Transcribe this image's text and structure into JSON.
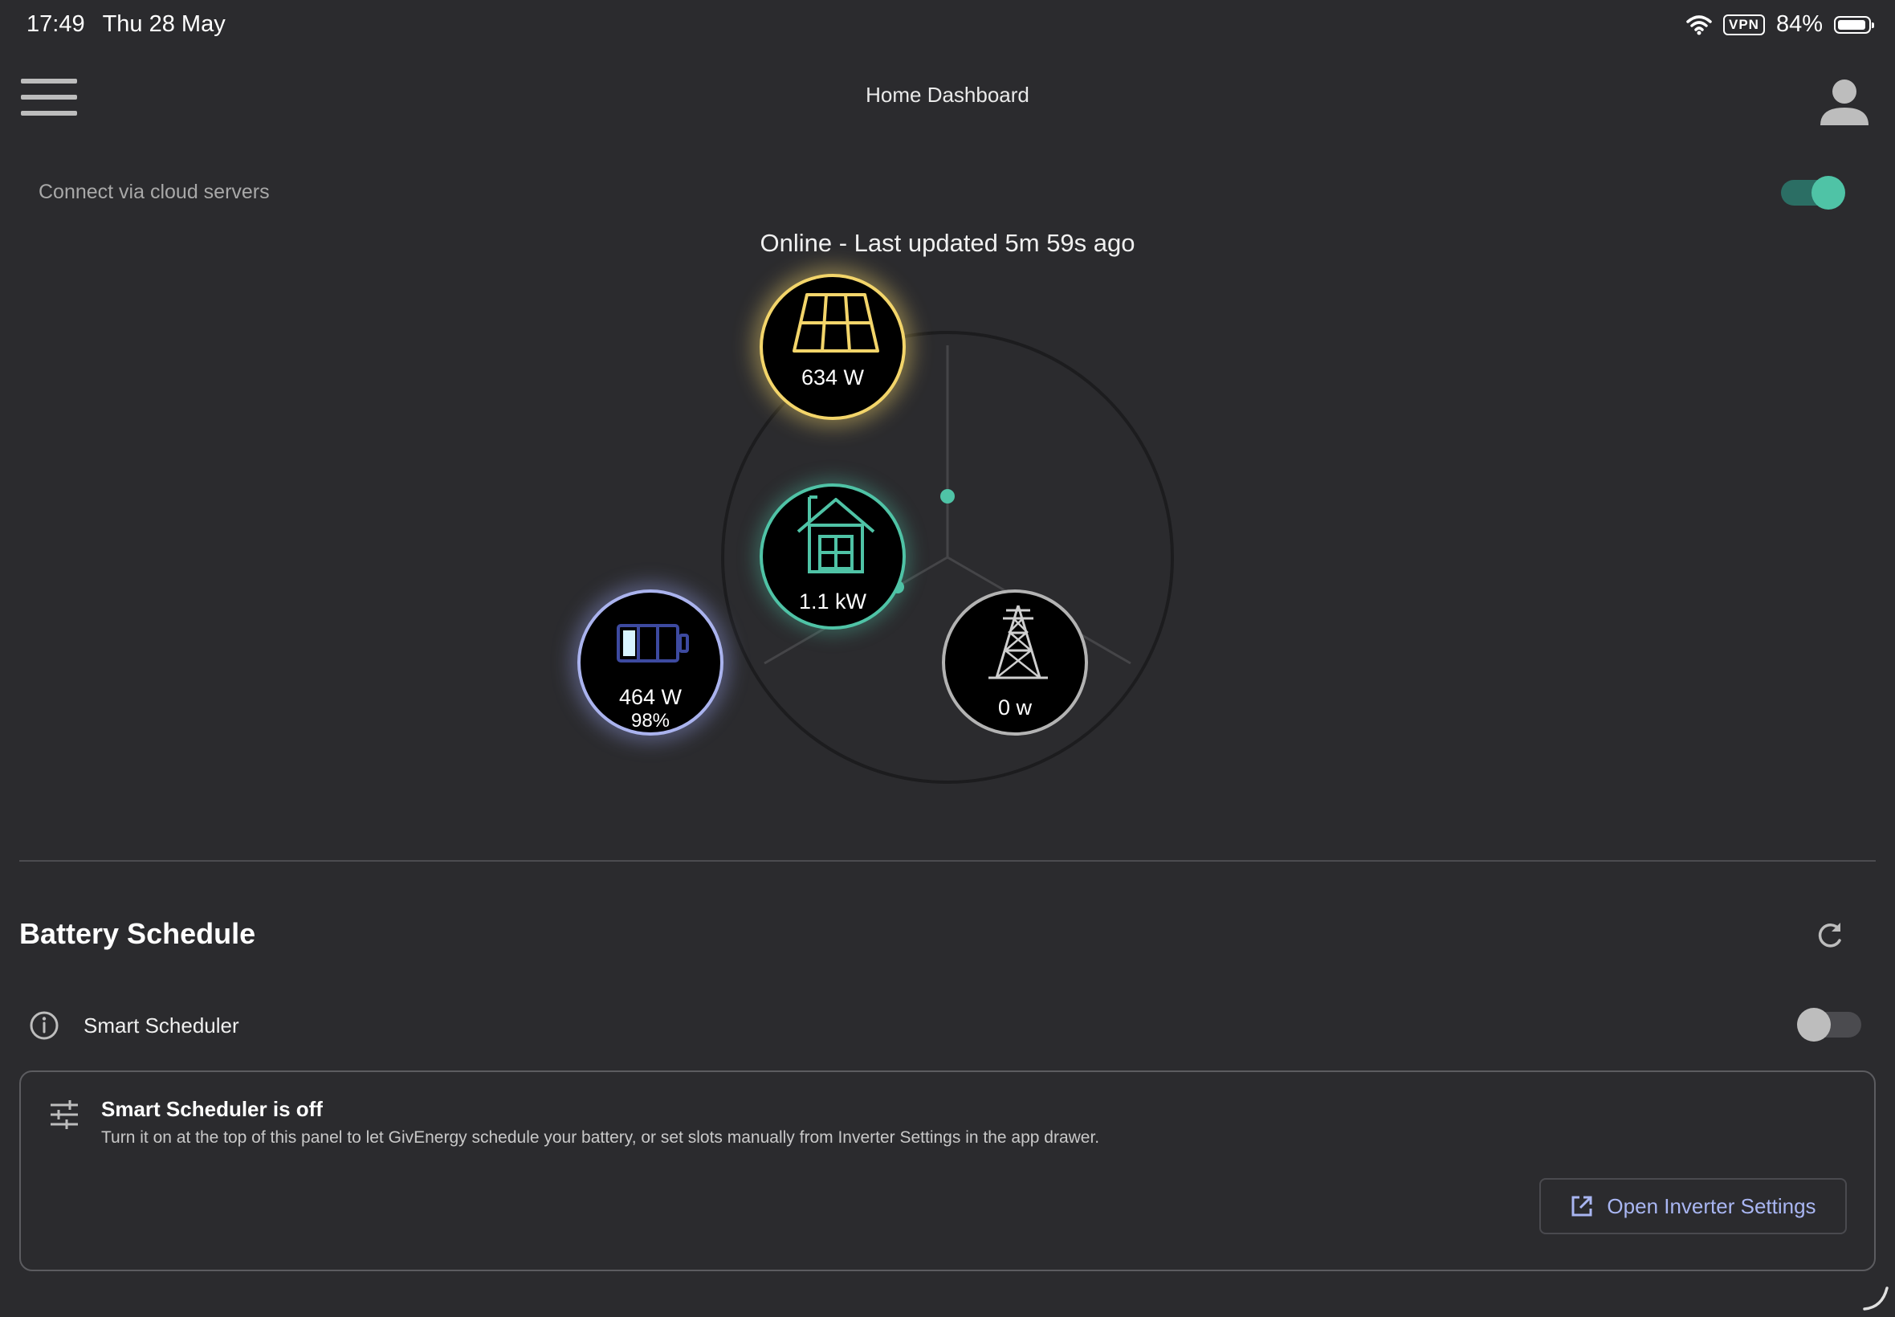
{
  "status_bar": {
    "time": "17:49",
    "date": "Thu 28 May",
    "vpn": "VPN",
    "battery_percent": "84%"
  },
  "header": {
    "title": "Home Dashboard"
  },
  "cloud": {
    "label": "Connect via cloud servers",
    "enabled": true
  },
  "status": {
    "text": "Online - Last updated 5m 59s ago"
  },
  "energy_flow": {
    "solar": {
      "value": "634 W",
      "color": "#f3d56a",
      "icon": "solar-panel-icon"
    },
    "home": {
      "value": "1.1 kW",
      "color": "#4fc3a6",
      "icon": "house-icon"
    },
    "battery": {
      "value": "464 W",
      "percent": "98%",
      "color": "#aab3ee",
      "icon": "battery-icon"
    },
    "grid": {
      "value": "0 w",
      "color": "#b3b3b3",
      "icon": "pylon-icon"
    }
  },
  "battery_schedule": {
    "title": "Battery Schedule",
    "smart_scheduler_label": "Smart Scheduler",
    "smart_scheduler_enabled": false,
    "card": {
      "title": "Smart Scheduler is off",
      "description": "Turn it on at the top of this panel to let GivEnergy schedule your battery, or set slots manually from Inverter Settings in the app drawer.",
      "button_label": "Open Inverter Settings"
    }
  },
  "colors": {
    "background": "#2b2b2e",
    "accent_teal": "#4fc3a6",
    "link": "#a9b6f2"
  }
}
